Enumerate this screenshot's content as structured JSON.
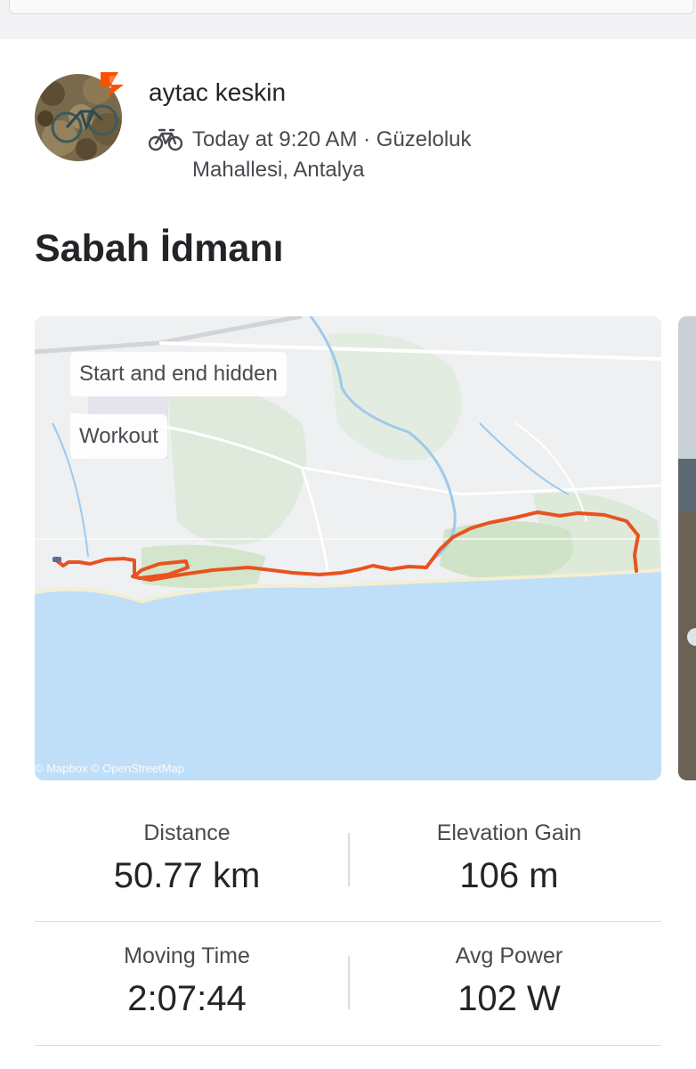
{
  "athlete": {
    "name": "aytac keskin"
  },
  "activity": {
    "sport_icon": "bike-icon",
    "meta": "Today at 9:20 AM · Güzeloluk Mahallesi, Antalya",
    "title": "Sabah İdmanı"
  },
  "map": {
    "chips": [
      "Start and end hidden",
      "Workout"
    ],
    "attribution": "© Mapbox © OpenStreetMap",
    "route_color": "#e8531f",
    "sea_color": "#bfdef8"
  },
  "stats": [
    {
      "label": "Distance",
      "value": "50.77 km"
    },
    {
      "label": "Elevation Gain",
      "value": "106 m"
    },
    {
      "label": "Moving Time",
      "value": "2:07:44"
    },
    {
      "label": "Avg Power",
      "value": "102 W"
    }
  ],
  "colors": {
    "brand": "#fc5200",
    "text": "#242428"
  }
}
